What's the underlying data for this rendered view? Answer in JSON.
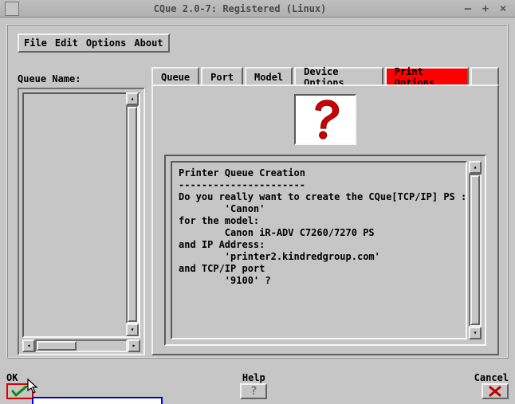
{
  "window": {
    "title": "CQue 2.0-7: Registered (Linux)"
  },
  "menu": {
    "file": "File",
    "edit": "Edit",
    "options": "Options",
    "about": "About"
  },
  "queue": {
    "label": "Queue Name:"
  },
  "tabs": {
    "queue": "Queue",
    "port": "Port",
    "model": "Model",
    "device": "Device Options",
    "print": "Print Options",
    "selected": "print"
  },
  "dialog": {
    "text_lines": "Printer Queue Creation\n----------------------\nDo you really want to create the CQue[TCP/IP] PS :\n        'Canon'\nfor the model:\n        Canon iR-ADV C7260/7270 PS\nand IP Address:\n        'printer2.kindredgroup.com'\nand TCP/IP port\n        '9100' ?\n"
  },
  "footer": {
    "ok": "OK",
    "help": "Help",
    "cancel": "Cancel"
  }
}
